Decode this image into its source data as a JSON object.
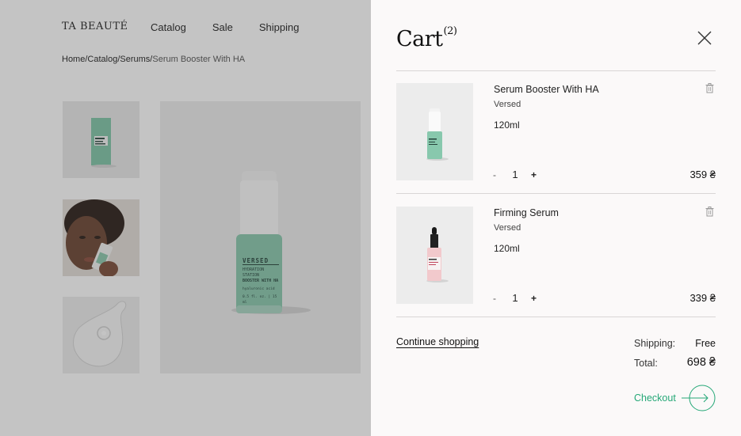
{
  "store": {
    "logo": "TA BEAUTÉ",
    "nav": [
      "Catalog",
      "Sale",
      "Shipping"
    ],
    "breadcrumb": {
      "path": [
        "Home",
        "Catalog",
        "Serums"
      ],
      "separator": "/",
      "current": "Serum Booster With HA"
    },
    "product_label": {
      "brand": "VERSED",
      "lines": [
        "HYDRATION",
        "STATION",
        "BOOSTER WITH HA"
      ],
      "sub": "hyaluronic acid",
      "volume": "0.5 fl. oz. | 15 ml"
    }
  },
  "cart": {
    "title": "Cart",
    "count": "(2)",
    "items": [
      {
        "name": "Serum Booster With HA",
        "brand": "Versed",
        "volume": "120ml",
        "qty": "1",
        "price": "359 ₴",
        "minus": "-",
        "plus": "+"
      },
      {
        "name": "Firming Serum",
        "brand": "Versed",
        "volume": "120ml",
        "qty": "1",
        "price": "339 ₴",
        "minus": "-",
        "plus": "+"
      }
    ],
    "continue_label": "Continue shopping",
    "shipping_label": "Shipping:",
    "shipping_value": "Free",
    "total_label": "Total:",
    "total_value": "698 ₴",
    "checkout_label": "Checkout"
  },
  "colors": {
    "accent": "#25a877",
    "drawer_bg": "#fbf9f9",
    "overlay": "rgba(60,60,60,0.30)",
    "bottle_green": "#7fc4a6",
    "bottle_pink": "#f2c9cc"
  }
}
